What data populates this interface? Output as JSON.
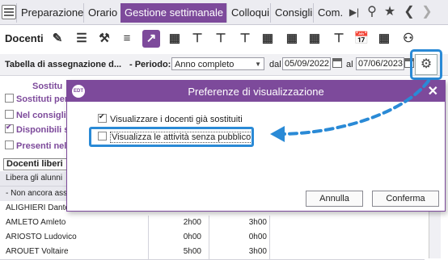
{
  "tabs": [
    {
      "label": "Preparazione"
    },
    {
      "label": "Orario"
    },
    {
      "label": "Gestione settimanale"
    },
    {
      "label": "Colloqui"
    },
    {
      "label": "Consigli"
    },
    {
      "label": "Com."
    }
  ],
  "top_icons": [
    "forward-icon",
    "search-icon",
    "star-icon",
    "back-arrow-icon",
    "forward-arrow-icon"
  ],
  "toolbar": {
    "title": "Docenti"
  },
  "filterbar": {
    "table_select": "Tabella di assegnazione d...",
    "period_label": "- Periodo:",
    "period_value": "Anno completo",
    "from_label": "dal",
    "from_date": "05/09/2022",
    "to_label": "al",
    "to_date": "07/06/2023"
  },
  "left_panel": {
    "heading": "Sostitu",
    "items": [
      {
        "label": "Sostituti per",
        "checked": false
      },
      {
        "label": "Nel consiglio",
        "checked": false
      },
      {
        "label": "Disponibili s",
        "checked": true
      },
      {
        "label": "Presenti nel",
        "checked": false
      }
    ],
    "select_value": "Docenti liberi"
  },
  "grid": {
    "rows": [
      {
        "name": "Libera gli alunni",
        "c1": "",
        "c2": ""
      },
      {
        "name": "- Non ancora ass",
        "c1": "",
        "c2": ""
      },
      {
        "name": "ALIGHIERI Dante",
        "c1": "",
        "c2": ""
      },
      {
        "name": "AMLETO Amleto",
        "c1": "2h00",
        "c2": "3h00"
      },
      {
        "name": "ARIOSTO Ludovico",
        "c1": "0h00",
        "c2": "0h00"
      },
      {
        "name": "AROUET Voltaire",
        "c1": "5h00",
        "c2": "3h00"
      }
    ]
  },
  "dialog": {
    "logo": "EDT",
    "title": "Preferenze di visualizzazione",
    "options": [
      {
        "label": "Visualizzare i docenti già sostituiti",
        "checked": true
      },
      {
        "label": "Visualizza le attività senza pubblico",
        "checked": false
      }
    ],
    "cancel_label": "Annulla",
    "confirm_label": "Conferma"
  },
  "colors": {
    "accent": "#7d4a9b",
    "highlight": "#2a8ad6"
  }
}
